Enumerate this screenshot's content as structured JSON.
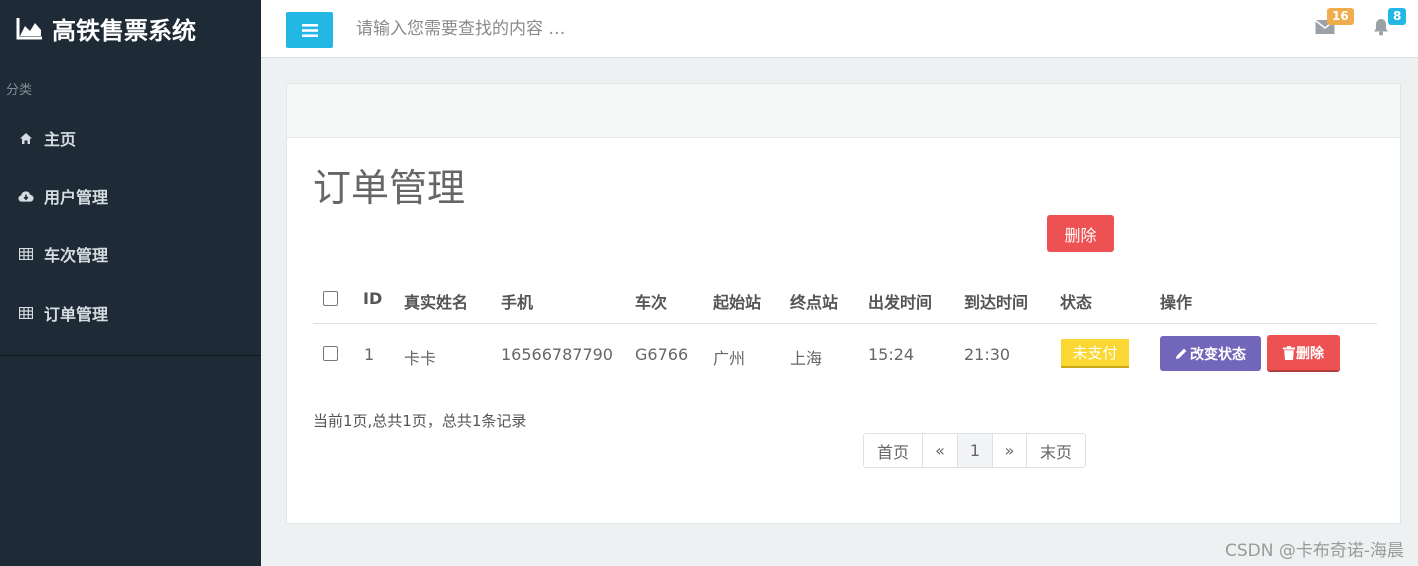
{
  "brand": {
    "title": "高铁售票系统"
  },
  "sidebar": {
    "category": "分类",
    "items": [
      {
        "label": "主页",
        "icon": "home-icon"
      },
      {
        "label": "用户管理",
        "icon": "cloud-download-icon"
      },
      {
        "label": "车次管理",
        "icon": "table-icon"
      },
      {
        "label": "订单管理",
        "icon": "table-icon"
      }
    ]
  },
  "topbar": {
    "search_placeholder": "请输入您需要查找的内容 …",
    "mail_count": "16",
    "bell_count": "8",
    "mail_badge_color": "#f0ad4e",
    "bell_badge_color": "#23b7e5"
  },
  "main": {
    "title": "订单管理",
    "delete_label": "删除",
    "table": {
      "headers": [
        "ID",
        "真实姓名",
        "手机",
        "车次",
        "起始站",
        "终点站",
        "出发时间",
        "到达时间",
        "状态",
        "操作"
      ],
      "rows": [
        {
          "id": "1",
          "name": "卡卡",
          "phone": "16566787790",
          "train": "G6766",
          "from": "广州",
          "to": "上海",
          "depart": "15:24",
          "arrive": "21:30",
          "status": "未支付",
          "change_label": "改变状态",
          "delete_label": "删除"
        }
      ]
    },
    "record_text": "当前1页,总共1页，总共1条记录",
    "pager": {
      "first": "首页",
      "prev": "«",
      "current": "1",
      "next": "»",
      "last": "末页"
    }
  },
  "watermark": "CSDN @卡布奇诺-海晨",
  "colors": {
    "sidebar_bg": "#1e2a35",
    "primary": "#23b7e5",
    "danger": "#ee5151",
    "warning": "#fad733",
    "purple": "#7266ba"
  }
}
